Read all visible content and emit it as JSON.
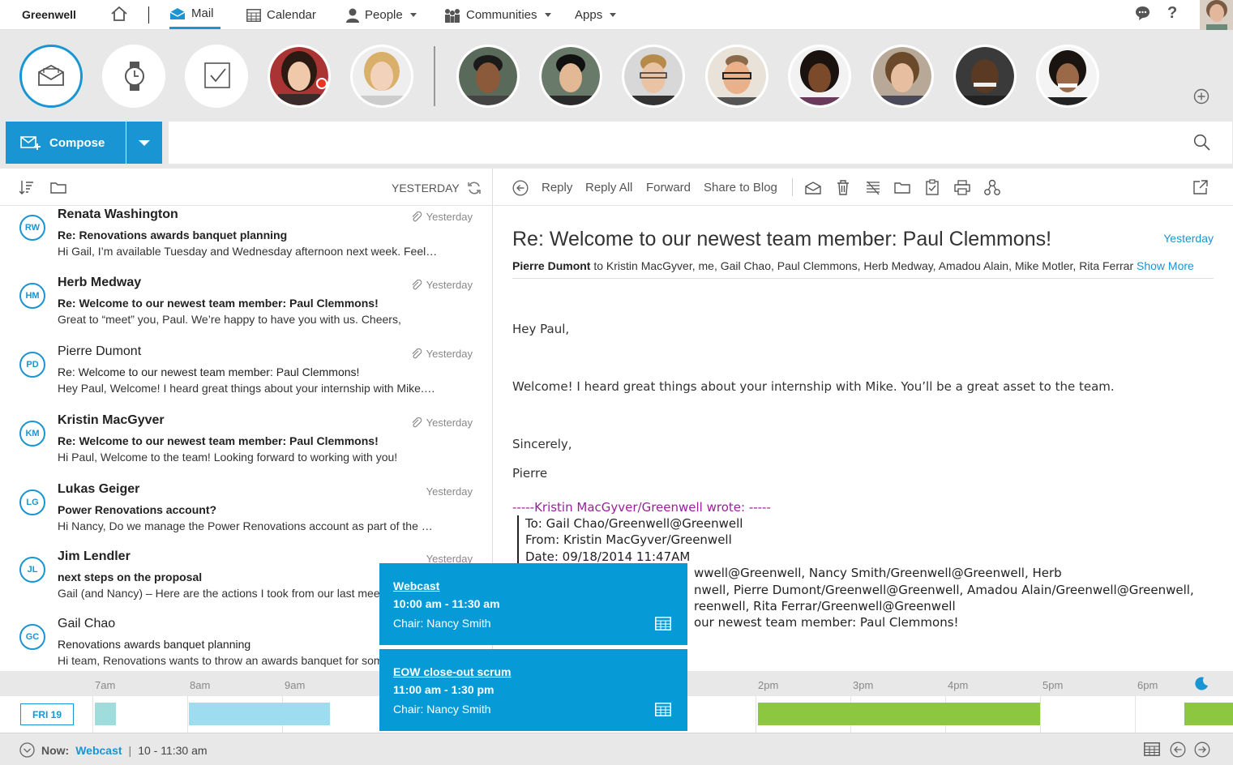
{
  "nav": {
    "brand": "Greenwell",
    "items": [
      {
        "label": "Mail",
        "active": true
      },
      {
        "label": "Calendar"
      },
      {
        "label": "People"
      },
      {
        "label": "Communities"
      },
      {
        "label": "Apps"
      }
    ]
  },
  "favorites": {
    "quick_icons": [
      "mail-icon",
      "watch-icon",
      "task-check-icon"
    ],
    "people_count_note": "",
    "add_icon": "plus-circle-icon"
  },
  "toolbar": {
    "compose_label": "Compose",
    "search_placeholder": ""
  },
  "list": {
    "date_group": "YESTERDAY",
    "messages": [
      {
        "initials": "RW",
        "sender": "Renata Washington",
        "subject": "Re: Renovations awards banquet planning",
        "preview": "Hi Gail, I’m available Tuesday and Wednesday afternoon next week. Feel…",
        "date": "Yesterday",
        "unread": true,
        "attachment": true
      },
      {
        "initials": "HM",
        "sender": "Herb Medway",
        "subject": "Re: Welcome to our newest team member: Paul Clemmons!",
        "preview": "Great to “meet” you, Paul. We’re happy to have you with us. Cheers,",
        "date": "Yesterday",
        "unread": true,
        "attachment": true
      },
      {
        "initials": "PD",
        "sender": "Pierre Dumont",
        "subject": "Re: Welcome to our newest team member: Paul Clemmons!",
        "preview": "Hey Paul, Welcome! I heard great things about your internship with Mike.…",
        "date": "Yesterday",
        "unread": false,
        "attachment": true
      },
      {
        "initials": "KM",
        "sender": "Kristin MacGyver",
        "subject": "Re: Welcome to our newest team member: Paul Clemmons!",
        "preview": "Hi Paul, Welcome to the team! Looking forward to working with you!",
        "date": "Yesterday",
        "unread": true,
        "attachment": true
      },
      {
        "initials": "LG",
        "sender": "Lukas Geiger",
        "subject": "Power Renovations account?",
        "preview": "Hi Nancy, Do we manage the Power Renovations account as part of the …",
        "date": "Yesterday",
        "unread": true,
        "attachment": false
      },
      {
        "initials": "JL",
        "sender": "Jim Lendler",
        "subject": "next steps on the proposal",
        "preview": "Gail (and Nancy) – Here are the actions I took from our last meeting",
        "date": "Yesterday",
        "unread": true,
        "attachment": false
      },
      {
        "initials": "GC",
        "sender": "Gail Chao",
        "subject": "Renovations awards banquet planning",
        "preview": "Hi team, Renovations wants to throw an awards banquet for some",
        "date": "",
        "unread": false,
        "attachment": false
      }
    ]
  },
  "reader": {
    "actions": {
      "reply": "Reply",
      "reply_all": "Reply All",
      "forward": "Forward",
      "share": "Share to Blog"
    },
    "subject": "Re: Welcome to our newest team member: Paul Clemmons!",
    "date": "Yesterday",
    "from": "Pierre Dumont",
    "to_line": "to Kristin MacGyver, me, Gail Chao, Paul Clemmons, Herb Medway, Amadou Alain, Mike Motler, Rita Ferrar",
    "show_more": "Show More",
    "greeting": "Hey Paul,",
    "body": "Welcome! I heard great things about your internship with Mike. You’ll be a great asset to the team.",
    "closing": "Sincerely,",
    "signature": "Pierre",
    "quote_header": "-----Kristin MacGyver/Greenwell wrote: -----",
    "quote_lines": [
      "To: Gail Chao/Greenwell@Greenwell",
      "From: Kristin MacGyver/Greenwell",
      "Date: 09/18/2014 11:47AM",
      "wwell@Greenwell, Nancy Smith/Greenwell@Greenwell, Herb",
      "nwell, Pierre Dumont/Greenwell@Greenwell, Amadou Alain/Greenwell@Greenwell,",
      "reenwell, Rita Ferrar/Greenwell@Greenwell",
      "our newest team member: Paul Clemmons!"
    ]
  },
  "popups": [
    {
      "title": "Webcast",
      "time": "10:00 am - 11:30 am",
      "chair": "Chair: Nancy Smith"
    },
    {
      "title": "EOW close-out scrum",
      "time": "11:00 am - 1:30 pm",
      "chair": "Chair: Nancy Smith"
    }
  ],
  "timeline": {
    "day_label": "FRI 19",
    "hours": [
      "7am",
      "8am",
      "9am",
      "2pm",
      "3pm",
      "4pm",
      "5pm",
      "6pm"
    ],
    "colors": {
      "light": "#9edcf0",
      "teal": "#a0dcdc",
      "green": "#8dc63f",
      "accent": "#1a95d3"
    }
  },
  "footer": {
    "now_label": "Now:",
    "now_event": "Webcast",
    "now_time": "10 - 11:30 am"
  }
}
